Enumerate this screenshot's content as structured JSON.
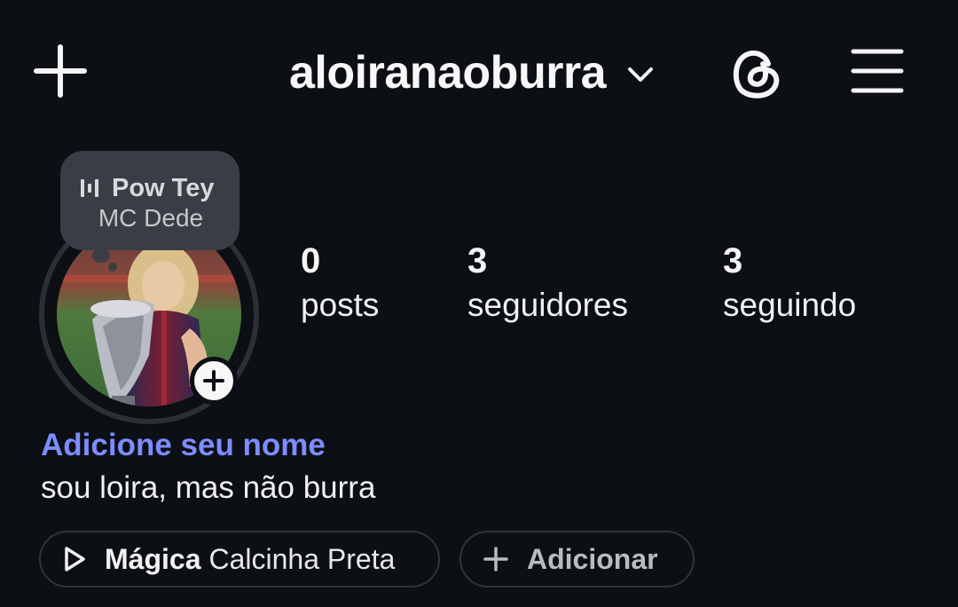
{
  "header": {
    "username": "aloiranaoburra"
  },
  "note": {
    "song": "Pow Tey",
    "artist": "MC Dede"
  },
  "stats": [
    {
      "value": "0",
      "label": "posts"
    },
    {
      "value": "3",
      "label": "seguidores"
    },
    {
      "value": "3",
      "label": "seguindo"
    }
  ],
  "profile": {
    "add_name": "Adicione seu nome",
    "bio": "sou loira, mas não burra"
  },
  "music": {
    "song": "Mágica",
    "artist": "Calcinha Preta"
  },
  "add_button": {
    "label": "Adicionar"
  },
  "colors": {
    "background": "#0c0f14",
    "link": "#7d8cff",
    "note_bubble": "#3a3d44"
  }
}
